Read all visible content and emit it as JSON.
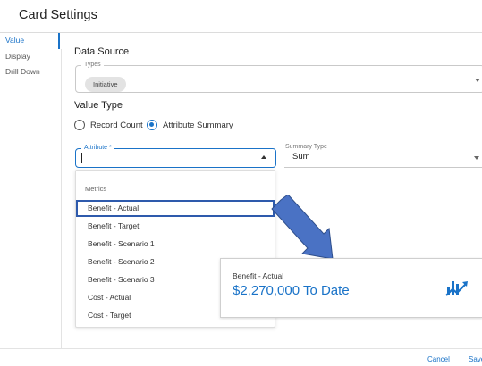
{
  "window": {
    "title": "Card Settings"
  },
  "sidebar": {
    "items": [
      {
        "label": "Value",
        "active": true
      },
      {
        "label": "Display",
        "active": false
      },
      {
        "label": "Drill Down",
        "active": false
      }
    ]
  },
  "data_source": {
    "title": "Data Source",
    "types_legend": "Types",
    "types_chip": "Initiative"
  },
  "value_type": {
    "title": "Value Type",
    "options": [
      {
        "label": "Record Count",
        "selected": false
      },
      {
        "label": "Attribute Summary",
        "selected": true
      }
    ]
  },
  "attribute": {
    "legend": "Attribute *",
    "value": ""
  },
  "summary_type": {
    "legend": "Summary Type",
    "value": "Sum"
  },
  "dropdown": {
    "header": "Metrics",
    "items": [
      "Benefit - Actual",
      "Benefit - Target",
      "Benefit - Scenario 1",
      "Benefit - Scenario 2",
      "Benefit - Scenario 3",
      "Cost - Actual",
      "Cost - Target"
    ],
    "highlighted_index": 0
  },
  "preview_card": {
    "label": "Benefit - Actual",
    "value": "$2,270,000 To Date",
    "icon": "trend-chart-icon"
  },
  "footer": {
    "cancel_label": "Cancel",
    "save_label": "Save"
  },
  "colors": {
    "accent": "#1a73c8",
    "highlight_border": "#2e5aac",
    "pointer_arrow": "#4a72c4"
  }
}
